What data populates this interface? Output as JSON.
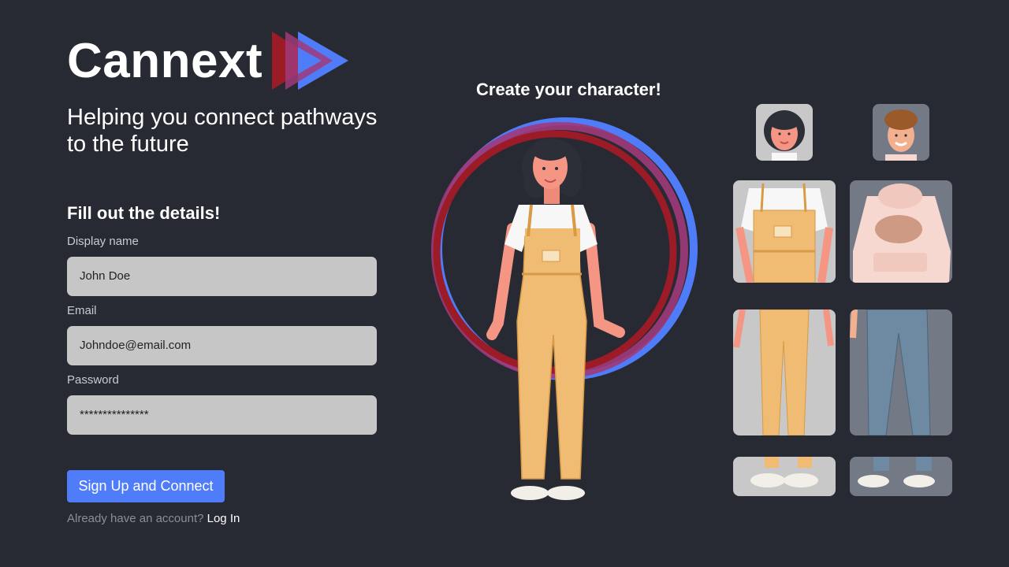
{
  "brand": {
    "name": "Cannext",
    "tagline": "Helping you connect pathways to the future"
  },
  "form": {
    "heading": "Fill out the details!",
    "display_name_label": "Display name",
    "display_name_value": "John Doe",
    "email_label": "Email",
    "email_value": "Johndoe@email.com",
    "password_label": "Password",
    "password_value": "***************",
    "submit_label": "Sign Up and Connect",
    "login_prompt": "Already have an account?",
    "login_link": "Log In"
  },
  "character": {
    "title": "Create your character!"
  },
  "colors": {
    "background": "#272a33",
    "accent_blue": "#4f7df9",
    "accent_red": "#9b1b26",
    "field": "#c6c6c6"
  }
}
